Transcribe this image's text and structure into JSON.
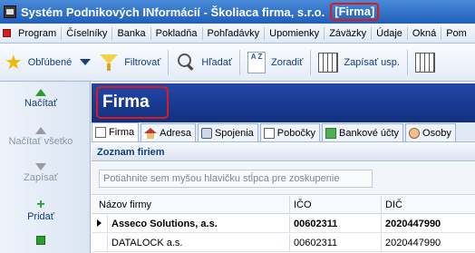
{
  "window": {
    "title": "Systém Podnikových INformácií - Školiaca firma, s.r.o.",
    "title_tag": "[Firma]"
  },
  "menu": {
    "items": [
      "Program",
      "Číselníky",
      "Banka",
      "Pokladňa",
      "Pohľadávky",
      "Upomienky",
      "Záväzky",
      "Údaje",
      "Okná",
      "Pom"
    ]
  },
  "toolbar": {
    "favorites_label": "Obľúbené",
    "filter_label": "Filtrovať",
    "search_label": "Hľadať",
    "sort_label": "Zoradiť",
    "sort_icon_text": "A Z",
    "write_label": "Zapísať usp."
  },
  "left_panel": {
    "load_label": "Načítať",
    "load_all_label": "Načítať všetko",
    "save_label": "Zapísať",
    "add_label": "Pridať"
  },
  "form": {
    "title": "Firma"
  },
  "tabs": [
    "Firma",
    "Adresa",
    "Spojenia",
    "Pobočky",
    "Bankové účty",
    "Osoby"
  ],
  "section": {
    "title": "Zoznam firiem",
    "group_hint": "Potiahnite sem myšou hlavičku stĺpca pre zoskupenie"
  },
  "grid": {
    "columns": [
      "Názov firmy",
      "IČO",
      "DIČ"
    ],
    "rows": [
      {
        "name": "Asseco Solutions, a.s.",
        "ico": "00602311",
        "dic": "2020447990"
      },
      {
        "name": "DATALOCK a.s.",
        "ico": "00602311",
        "dic": "2020447990"
      }
    ]
  },
  "colors": {
    "title_bar": "#1f5fb8",
    "header_band": "#1a3a96",
    "highlight": "#e01818"
  }
}
